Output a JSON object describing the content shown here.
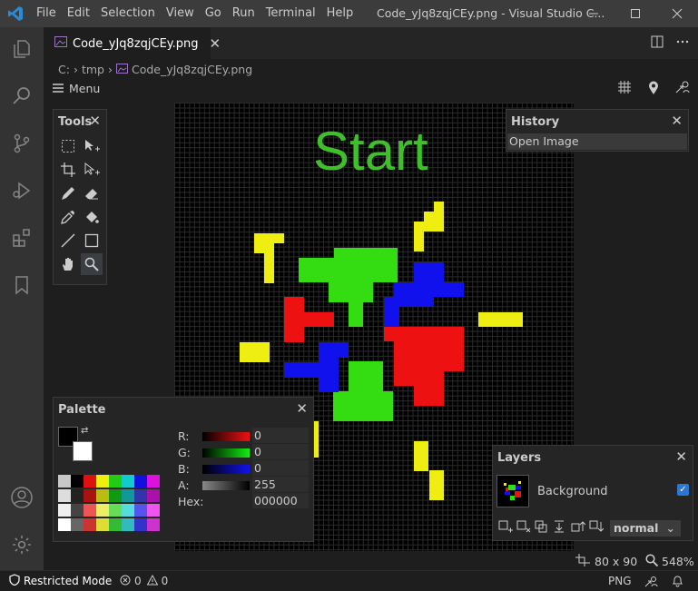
{
  "titlebar": {
    "menu": [
      "File",
      "Edit",
      "Selection",
      "View",
      "Go",
      "Run",
      "Terminal",
      "Help"
    ],
    "window_title": "Code_yJq8zqjCEy.png - Visual Studio C..."
  },
  "activity_icons": [
    "files-icon",
    "search-icon",
    "source-control-icon",
    "run-debug-icon",
    "extensions-icon",
    "bookmark-icon",
    "account-icon",
    "settings-gear-icon"
  ],
  "tab": {
    "label": "Code_yJq8zqjCEy.png",
    "close": "✕"
  },
  "breadcrumb": [
    "C:",
    "tmp",
    "Code_yJq8zqjCEy.png"
  ],
  "editor": {
    "menu_label": "Menu",
    "canvas_text": "Start"
  },
  "tools_panel": {
    "title": "Tools"
  },
  "history_panel": {
    "title": "History",
    "items": [
      "Open Image"
    ]
  },
  "palette_panel": {
    "title": "Palette",
    "labels": {
      "r": "R:",
      "g": "G:",
      "b": "B:",
      "a": "A:",
      "hex": "Hex:"
    },
    "values": {
      "r": "0",
      "g": "0",
      "b": "0",
      "a": "255",
      "hex": "000000"
    }
  },
  "layers_panel": {
    "title": "Layers",
    "layer_name": "Background",
    "blend_mode": "normal"
  },
  "image_info": {
    "size": "80 x 90",
    "zoom": "548%"
  },
  "statusbar": {
    "restricted": "Restricted Mode",
    "errors": "0",
    "warnings": "0",
    "language": "PNG"
  },
  "colors": {
    "green": "#33dd11",
    "red": "#ee1111",
    "blue": "#1111ee",
    "yellow": "#eeee11",
    "start_text": "#3fbf2a"
  }
}
